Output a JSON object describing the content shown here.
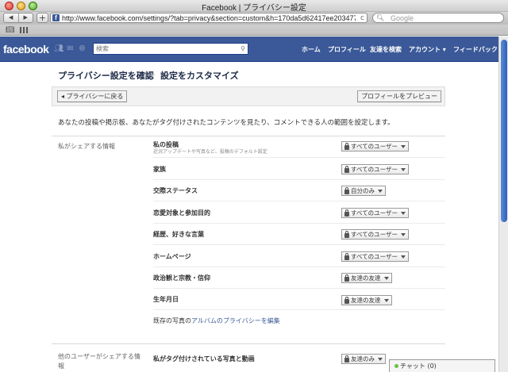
{
  "window": {
    "title": "Facebook | プライバシー設定"
  },
  "browser": {
    "url": "http://www.facebook.com/settings/?tab=privacy&section=custom&h=170da5d62417ee203477e&",
    "search_placeholder": "Google",
    "back_glyph": "◀",
    "forward_glyph": "▶",
    "add_glyph": "+",
    "reload_glyph": "c"
  },
  "fb_header": {
    "logo": "facebook",
    "search_placeholder": "検索",
    "nav": {
      "home": "ホーム",
      "profile": "プロフィール",
      "find_friends": "友達を検索",
      "account": "アカウント ▾",
      "feedback": "フィードバック"
    },
    "icons": [
      "friend-requests-icon",
      "messages-icon",
      "notifications-icon"
    ]
  },
  "breadcrumb": {
    "parent": "プライバシー設定を確認",
    "current": "設定をカスタマイズ"
  },
  "toolbar": {
    "back_label": "◂ プライバシーに戻る",
    "preview_label": "プロフィールをプレビュー"
  },
  "description": "あなたの投稿や掲示板、あなたがタグ付けされたコンテンツを見たり、コメントできる人の範囲を設定します。",
  "section_share": {
    "label": "私がシェアする情報",
    "rows": [
      {
        "label": "私の投稿",
        "sub": "近況アップデートや写真など、投稿のデフォルト設定",
        "setting": "すべてのユーザー"
      },
      {
        "label": "家族",
        "setting": "すべてのユーザー"
      },
      {
        "label": "交際ステータス",
        "setting": "自分のみ"
      },
      {
        "label": "恋愛対象と参加目的",
        "setting": "すべてのユーザー"
      },
      {
        "label": "経歴、好きな言葉",
        "setting": "すべてのユーザー"
      },
      {
        "label": "ホームページ",
        "setting": "すべてのユーザー"
      },
      {
        "label": "政治観と宗教・信仰",
        "setting": "友達の友達"
      },
      {
        "label": "生年月日",
        "setting": "友達の友達"
      }
    ],
    "album_prefix": "既存の写真の",
    "album_link": "アルバムのプライバシーを編集"
  },
  "section_others": {
    "label_line1": "他のユーザーがシェアする情",
    "label_line2": "報",
    "rows": [
      {
        "label": "私がタグ付けされている写真と動画",
        "setting": "友達のみ"
      }
    ]
  },
  "chat": {
    "label": "チャット (0)"
  }
}
